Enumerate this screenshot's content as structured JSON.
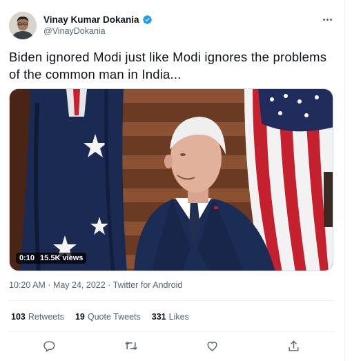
{
  "author": {
    "name": "Vinay Kumar Dokania",
    "handle": "@VinayDokania",
    "verified": true
  },
  "tweet": {
    "text": "Biden ignored Modi just like Modi ignores the problems of the common man in India..."
  },
  "video": {
    "duration": "0:10",
    "views": "15.5K views"
  },
  "meta": {
    "time": "10:20 AM",
    "dot1": " · ",
    "date": "May 24, 2022",
    "dot2": " · ",
    "source": "Twitter for Android"
  },
  "stats": {
    "retweets_count": "103",
    "retweets_label": "Retweets",
    "quotes_count": "19",
    "quotes_label": "Quote Tweets",
    "likes_count": "331",
    "likes_label": "Likes"
  },
  "icons": {
    "reply": "reply-icon",
    "retweet": "retweet-icon",
    "like": "heart-icon",
    "share": "share-icon",
    "more": "more-icon"
  },
  "colors": {
    "verified": "#1d9bf0",
    "secondary_text": "#536471",
    "primary_text": "#0f1419"
  }
}
